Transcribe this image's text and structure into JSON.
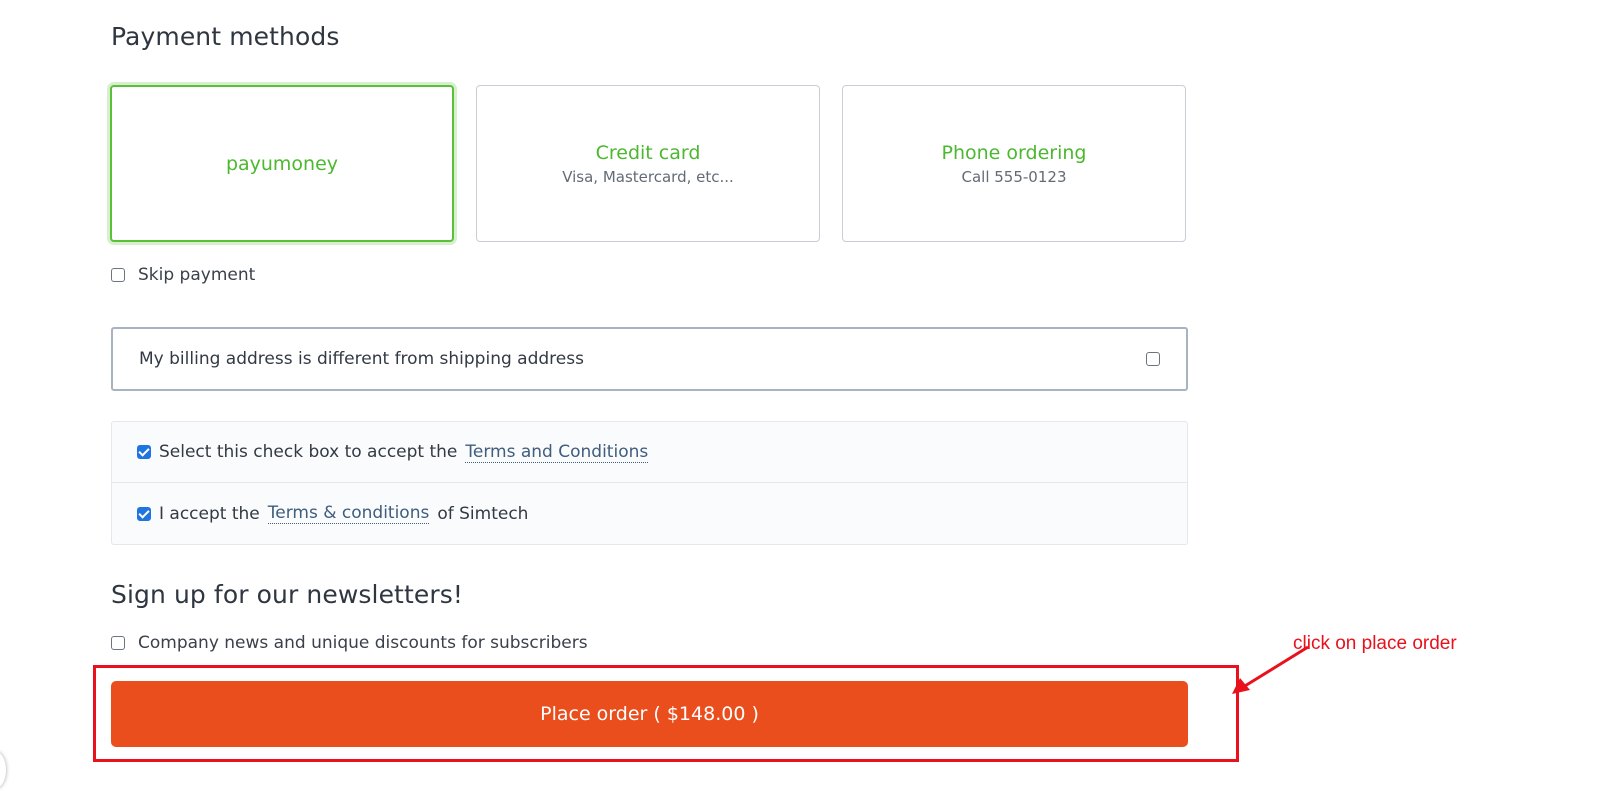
{
  "payment": {
    "title": "Payment methods",
    "methods": [
      {
        "name": "payumoney",
        "desc": "",
        "selected": true
      },
      {
        "name": "Credit card",
        "desc": "Visa, Mastercard, etc...",
        "selected": false
      },
      {
        "name": "Phone ordering",
        "desc": "Call 555-0123",
        "selected": false
      }
    ],
    "skip_label": "Skip payment",
    "skip_checked": false
  },
  "billing": {
    "label": "My billing address is different from shipping address",
    "checked": false
  },
  "terms": {
    "row1_prefix": "Select this check box to accept the",
    "row1_link": "Terms and Conditions",
    "row1_checked": true,
    "row2_prefix": "I accept the",
    "row2_link": "Terms & conditions",
    "row2_suffix": "of Simtech",
    "row2_checked": true
  },
  "newsletter": {
    "title": "Sign up for our newsletters!",
    "option_label": "Company news and unique discounts for subscribers",
    "option_checked": false
  },
  "order": {
    "button_label": "Place order ( $148.00 )"
  },
  "annotation": {
    "text": "click on place order",
    "color": "#e8111c"
  },
  "colors": {
    "accent_green": "#4cb82f",
    "place_order": "#ea4e1d",
    "checkbox_checked": "#1f74e0"
  }
}
